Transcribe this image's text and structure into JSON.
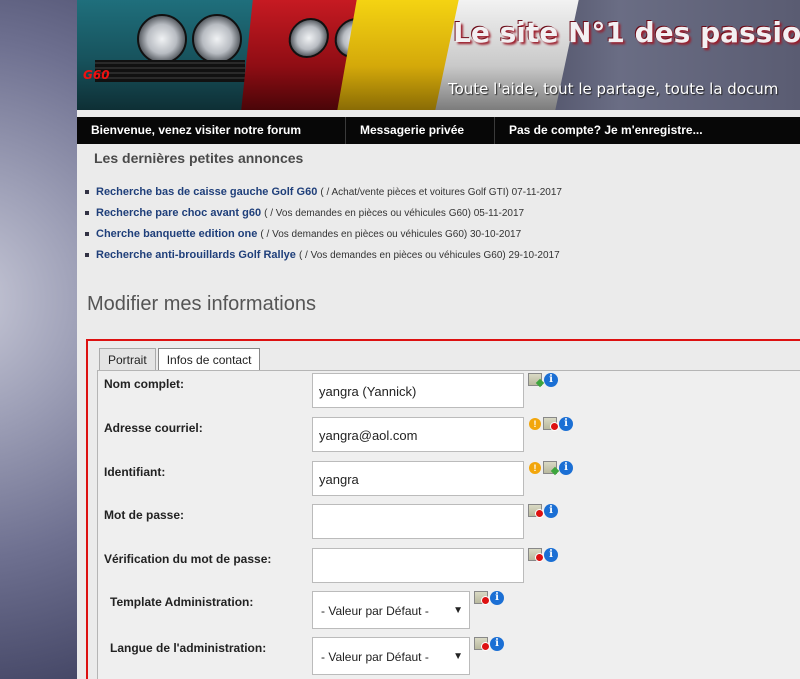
{
  "header": {
    "title": "Le site N°1 des passio",
    "tagline": "Toute l'aide, tout le partage, toute la docum",
    "car_badge": "G60"
  },
  "nav": {
    "items": [
      {
        "label": "Bienvenue, venez visiter notre forum"
      },
      {
        "label": "Messagerie privée"
      },
      {
        "label": "Pas de compte? Je m'enregistre..."
      }
    ]
  },
  "announcements": {
    "title": "Les dernières petites annonces",
    "items": [
      {
        "link": "Recherche bas de caisse gauche Golf G60",
        "meta": "( / Achat/vente pièces et voitures Golf GTI) 07-11-2017"
      },
      {
        "link": "Recherche pare choc avant g60",
        "meta": "( / Vos demandes en pièces ou véhicules G60) 05-11-2017"
      },
      {
        "link": "Cherche banquette edition one",
        "meta": "( / Vos demandes en pièces ou véhicules G60) 30-10-2017"
      },
      {
        "link": "Recherche anti-brouillards Golf Rallye",
        "meta": "( / Vos demandes en pièces ou véhicules G60) 29-10-2017"
      }
    ]
  },
  "form": {
    "heading": "Modifier mes informations",
    "tabs": [
      {
        "label": "Portrait",
        "active": false
      },
      {
        "label": "Infos de contact",
        "active": true
      }
    ],
    "fields": {
      "full_name": {
        "label": "Nom complet:",
        "value": "yangra (Yannick)"
      },
      "email": {
        "label": "Adresse courriel:",
        "value": "yangra@aol.com"
      },
      "username": {
        "label": "Identifiant:",
        "value": "yangra"
      },
      "password": {
        "label": "Mot de passe:",
        "value": ""
      },
      "password_confirm": {
        "label": "Vérification du mot de passe:",
        "value": ""
      },
      "admin_template": {
        "label": "Template Administration:",
        "selected": "- Valeur par Défaut -"
      },
      "admin_language": {
        "label": "Langue de l'administration:",
        "selected": "- Valeur par Défaut -"
      }
    },
    "icon_glyphs": {
      "info": "i",
      "warning": "!"
    }
  },
  "colors": {
    "nav_bg": "#070707",
    "link": "#1f3f7a",
    "form_border": "#dd1111",
    "info_icon": "#1b6fd4",
    "warning_icon": "#f2a60c"
  }
}
